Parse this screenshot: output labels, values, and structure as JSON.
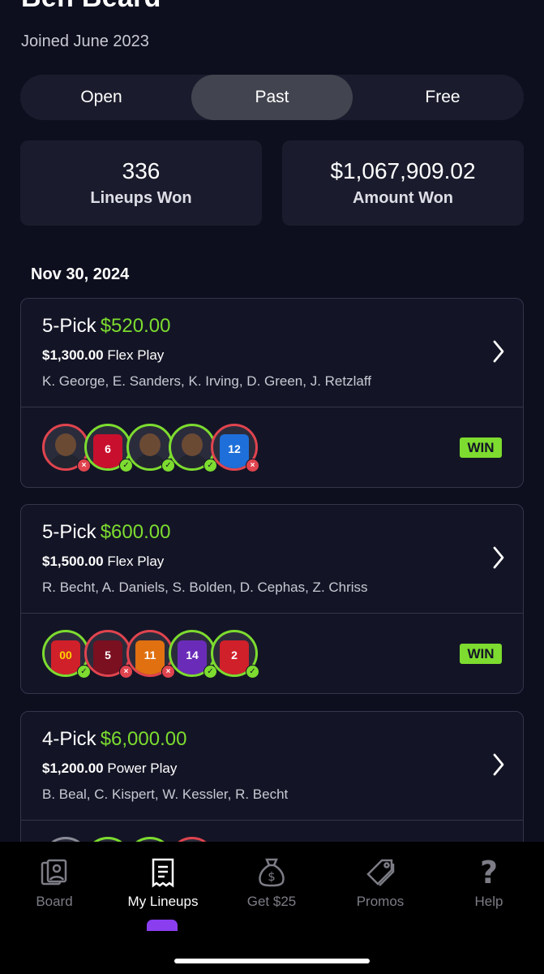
{
  "profile": {
    "name": "Ben Beard",
    "joined": "Joined June 2023"
  },
  "tabs": [
    {
      "label": "Open",
      "active": false
    },
    {
      "label": "Past",
      "active": true
    },
    {
      "label": "Free",
      "active": false
    }
  ],
  "stats": [
    {
      "value": "336",
      "label": "Lineups Won"
    },
    {
      "value": "$1,067,909.02",
      "label": "Amount Won"
    }
  ],
  "date_header": "Nov 30, 2024",
  "lineups": [
    {
      "pick": "5-Pick",
      "payout": "$520.00",
      "entry": "$1,300.00",
      "play": "Flex Play",
      "players": "K. George, E. Sanders, K. Irving, D. Green, J. Retzlaff",
      "result": "WIN",
      "avatars": [
        {
          "kind": "photo",
          "result": "loss"
        },
        {
          "kind": "jersey",
          "number": "6",
          "color": "#c8102e",
          "text": "#ffffff",
          "result": "win"
        },
        {
          "kind": "photo",
          "result": "win"
        },
        {
          "kind": "photo",
          "result": "win"
        },
        {
          "kind": "jersey",
          "number": "12",
          "color": "#1e6fd9",
          "text": "#ffffff",
          "result": "loss"
        }
      ]
    },
    {
      "pick": "5-Pick",
      "payout": "$600.00",
      "entry": "$1,500.00",
      "play": "Flex Play",
      "players": "R. Becht, A. Daniels, S. Bolden, D. Cephas, Z. Chriss",
      "result": "WIN",
      "avatars": [
        {
          "kind": "jersey",
          "number": "00",
          "color": "#d0202a",
          "text": "#ffd400",
          "result": "win"
        },
        {
          "kind": "jersey",
          "number": "5",
          "color": "#7a1020",
          "text": "#ffffff",
          "result": "loss"
        },
        {
          "kind": "jersey",
          "number": "11",
          "color": "#e07010",
          "text": "#ffffff",
          "result": "loss"
        },
        {
          "kind": "jersey",
          "number": "14",
          "color": "#6a2cb8",
          "text": "#ffffff",
          "result": "win"
        },
        {
          "kind": "jersey",
          "number": "2",
          "color": "#d0202a",
          "text": "#ffffff",
          "result": "win"
        }
      ]
    },
    {
      "pick": "4-Pick",
      "payout": "$6,000.00",
      "entry": "$1,200.00",
      "play": "Power Play",
      "players": "B. Beal, C. Kispert, W. Kessler, R. Becht",
      "result": "",
      "avatars": [
        {
          "kind": "photo",
          "result": "neutral"
        },
        {
          "kind": "photo",
          "result": "win"
        },
        {
          "kind": "photo",
          "result": "win"
        },
        {
          "kind": "jersey",
          "number": "",
          "color": "#d0202a",
          "text": "#ffffff",
          "result": "loss"
        }
      ]
    }
  ],
  "nav": [
    {
      "label": "Board",
      "icon": "board-icon",
      "active": false
    },
    {
      "label": "My Lineups",
      "icon": "receipt-icon",
      "active": true
    },
    {
      "label": "Get $25",
      "icon": "money-bag-icon",
      "active": false
    },
    {
      "label": "Promos",
      "icon": "tag-icon",
      "active": false
    },
    {
      "label": "Help",
      "icon": "question-icon",
      "active": false
    }
  ],
  "colors": {
    "accent": "#7ddc2f",
    "loss": "#e0444e",
    "nav_indicator": "#8a3ef0",
    "background": "#0e0f1e"
  }
}
